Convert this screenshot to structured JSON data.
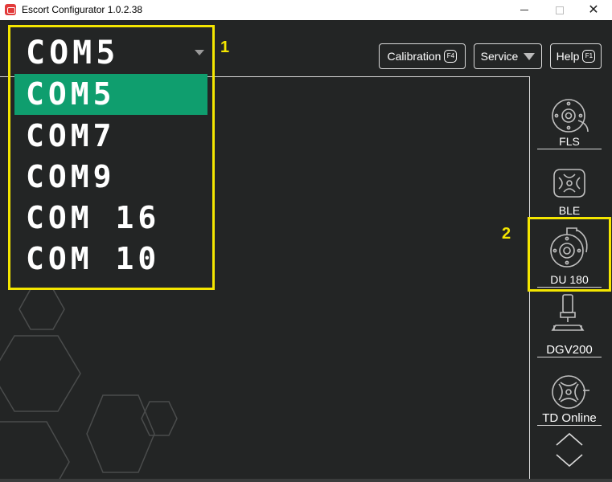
{
  "window": {
    "title": "Escort Configurator 1.0.2.38",
    "minimize_glyph": "",
    "close_glyph": "✕"
  },
  "com_port": {
    "selected": "COM5",
    "options": [
      "COM5",
      "COM7",
      "COM9",
      "COM 16",
      "COM 10"
    ],
    "active_index": 0
  },
  "toolbar": {
    "calibration_label": "Calibration",
    "calibration_key": "F4",
    "service_label": "Service",
    "help_label": "Help",
    "help_key": "F1"
  },
  "sidebar": {
    "items": [
      {
        "label": "FLS",
        "icon": "fls-sensor-icon"
      },
      {
        "label": "BLE",
        "icon": "ble-sensor-icon"
      },
      {
        "label": "DU 180",
        "icon": "du180-sensor-icon"
      },
      {
        "label": "DGV200",
        "icon": "dgv200-sensor-icon"
      },
      {
        "label": "TD Online",
        "icon": "td-online-sensor-icon"
      }
    ]
  },
  "annotations": {
    "marker_1": "1",
    "marker_2": "2"
  },
  "colors": {
    "background": "#232525",
    "active_option": "#0f9e6e",
    "annotation": "#f4e600"
  }
}
